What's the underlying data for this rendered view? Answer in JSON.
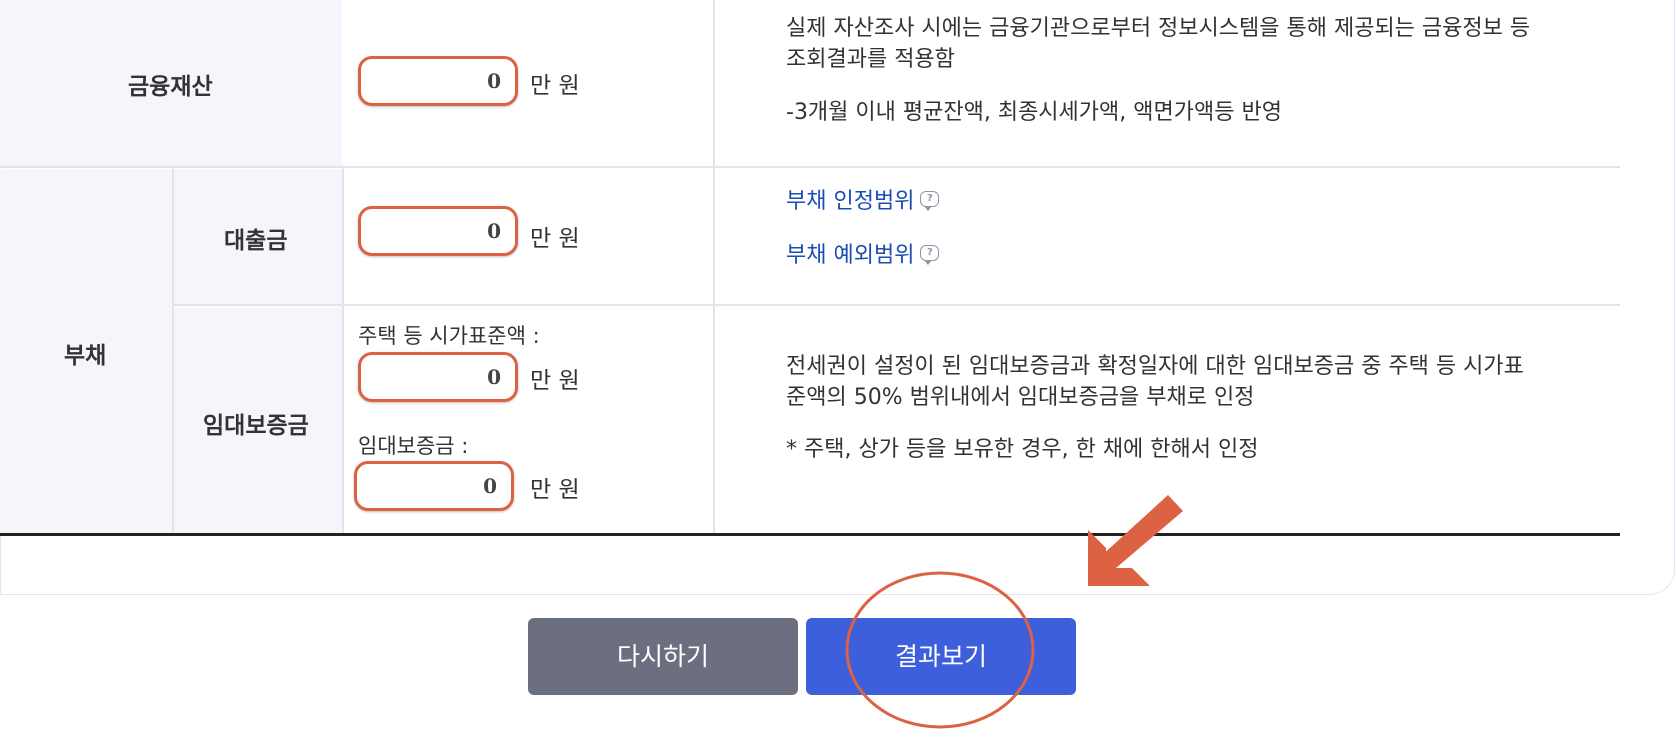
{
  "financial_assets": {
    "label": "금융재산",
    "value": "0",
    "unit": "만 원",
    "desc_line1": "실제 자산조사 시에는 금융기관으로부터 정보시스템을 통해 제공되는 금융정보 등",
    "desc_line2": "조회결과를 적용함",
    "desc_line3": "-3개월 이내 평균잔액, 최종시세가액, 액면가액등 반영"
  },
  "debt": {
    "label": "부채",
    "loan": {
      "label": "대출금",
      "value": "0",
      "unit": "만 원",
      "link1": "부채 인정범위",
      "link2": "부채 예외범위"
    },
    "deposit": {
      "label": "임대보증금",
      "field1_label": "주택 등 시가표준액 :",
      "field1_value": "0",
      "field2_label": "임대보증금 :",
      "field2_value": "0",
      "unit": "만 원",
      "desc_line1": "전세권이 설정이 된 임대보증금과 확정일자에 대한 임대보증금 중 주택 등 시가표",
      "desc_line2": "준액의 50% 범위내에서 임대보증금을 부채로 인정",
      "desc_line3": "* 주택, 상가 등을 보유한 경우, 한 채에 한해서 인정"
    }
  },
  "buttons": {
    "reset": "다시하기",
    "result": "결과보기"
  },
  "colors": {
    "accent_annotation": "#dc6243",
    "primary_button": "#3d5fdc",
    "secondary_button": "#6b6f7f",
    "link": "#1b4db3"
  },
  "icons": {
    "help": "help-bubble-icon",
    "arrow": "arrow-down-left-icon"
  }
}
